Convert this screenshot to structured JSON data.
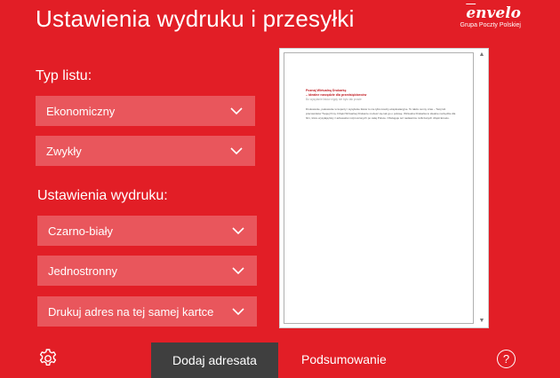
{
  "header": {
    "title": "Ustawienia wydruku i przesyłki",
    "logo": {
      "lead": "e",
      "word": "nvelo",
      "sub": "Grupa Poczty Polskiej"
    }
  },
  "letter_type": {
    "label": "Typ listu:",
    "type_value": "Ekonomiczny",
    "class_value": "Zwykły"
  },
  "print_settings": {
    "label": "Ustawienia wydruku:",
    "color_value": "Czarno-biały",
    "sides_value": "Jednostronny",
    "address_value": "Drukuj adres na tej samej kartce"
  },
  "preview": {
    "heading_line1": "Poznaj Wirtualną Drukarkę",
    "heading_line2": "– idealne narzędzie dla przedsiębiorców",
    "subheading": "Bo wysyłanie listów nigdy nie było tak proste",
    "body": "Drukowanie, pakowanie w koperty i wysyłanie listów to nie tylko koszty eksploatacyjne. To także cenny czas – Twój lub pracowników Twojej firmy. Dzięki Wirtualnej Drukarce możesz się tak go o połowę. Wirtualna Drukarka to idealne narzędzie dla firm, które wysyłają listy z adresatów rozproszonych po całej Polsce. Obsługuje też nadawców rozliczanych dzięki Envelo."
  },
  "footer": {
    "add_recipient_label": "Dodaj adresata",
    "summary_label": "Podsumowanie",
    "help_label": "?"
  },
  "colors": {
    "background": "#e21e26",
    "dark_button": "#3f3f3f",
    "select_fill": "rgba(255,255,255,0.25)"
  }
}
